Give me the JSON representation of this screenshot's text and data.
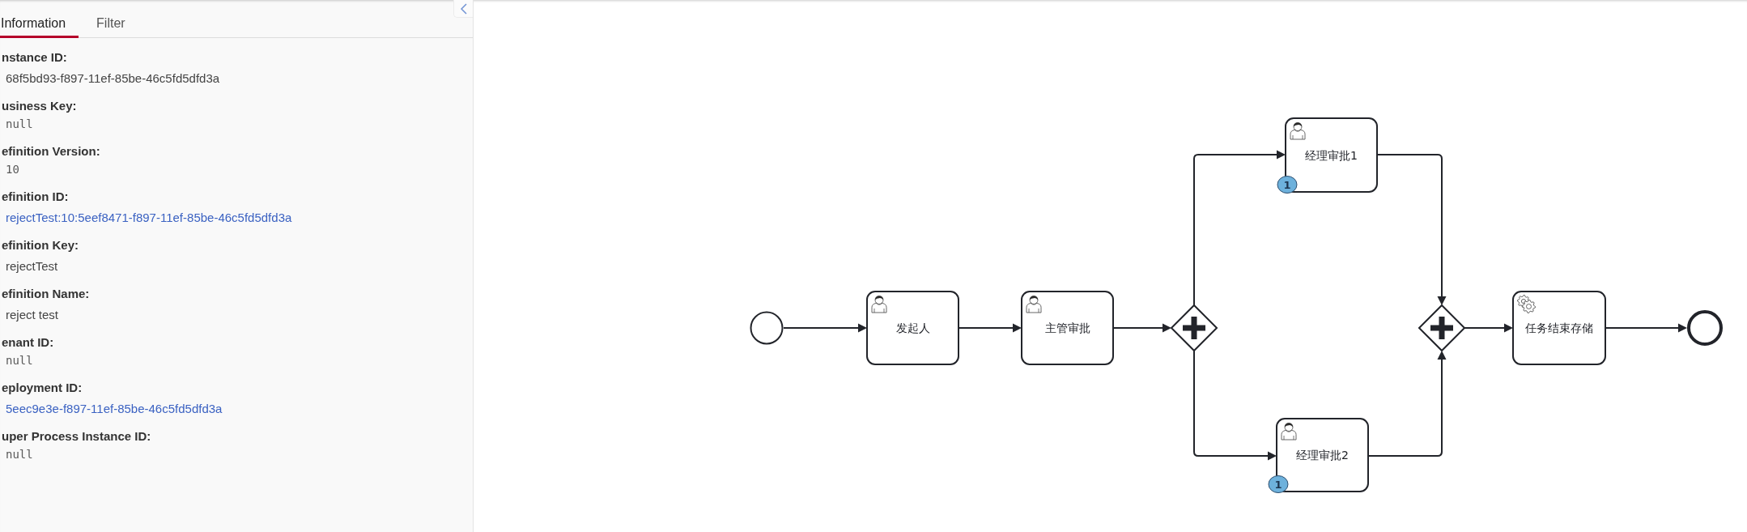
{
  "tabs": [
    {
      "label": "Information",
      "selected": true
    },
    {
      "label": "Filter",
      "selected": false
    }
  ],
  "details": [
    {
      "label": "nstance ID:",
      "value": "68f5bd93-f897-11ef-85be-46c5fd5dfd3a",
      "kind": "text"
    },
    {
      "label": "usiness Key:",
      "value": "null",
      "kind": "code"
    },
    {
      "label": "efinition Version:",
      "value": "10",
      "kind": "code"
    },
    {
      "label": "efinition ID:",
      "value": "rejectTest:10:5eef8471-f897-11ef-85be-46c5fd5dfd3a",
      "kind": "link"
    },
    {
      "label": "efinition Key:",
      "value": "rejectTest",
      "kind": "text"
    },
    {
      "label": "efinition Name:",
      "value": "reject test",
      "kind": "text"
    },
    {
      "label": "enant ID:",
      "value": "null",
      "kind": "code"
    },
    {
      "label": "eployment ID:",
      "value": "5eec9e3e-f897-11ef-85be-46c5fd5dfd3a",
      "kind": "link"
    },
    {
      "label": "uper Process Instance ID:",
      "value": "null",
      "kind": "code"
    }
  ],
  "diagram": {
    "nodes": [
      {
        "kind": "start-event"
      },
      {
        "kind": "user-task",
        "label": "发起人"
      },
      {
        "kind": "user-task",
        "label": "主管审批"
      },
      {
        "kind": "parallel-gateway"
      },
      {
        "kind": "user-task",
        "label": "经理审批1",
        "badge": "1"
      },
      {
        "kind": "user-task",
        "label": "经理审批2",
        "badge": "1"
      },
      {
        "kind": "parallel-gateway"
      },
      {
        "kind": "service-task",
        "label": "任务结束存储"
      },
      {
        "kind": "end-event"
      }
    ]
  }
}
